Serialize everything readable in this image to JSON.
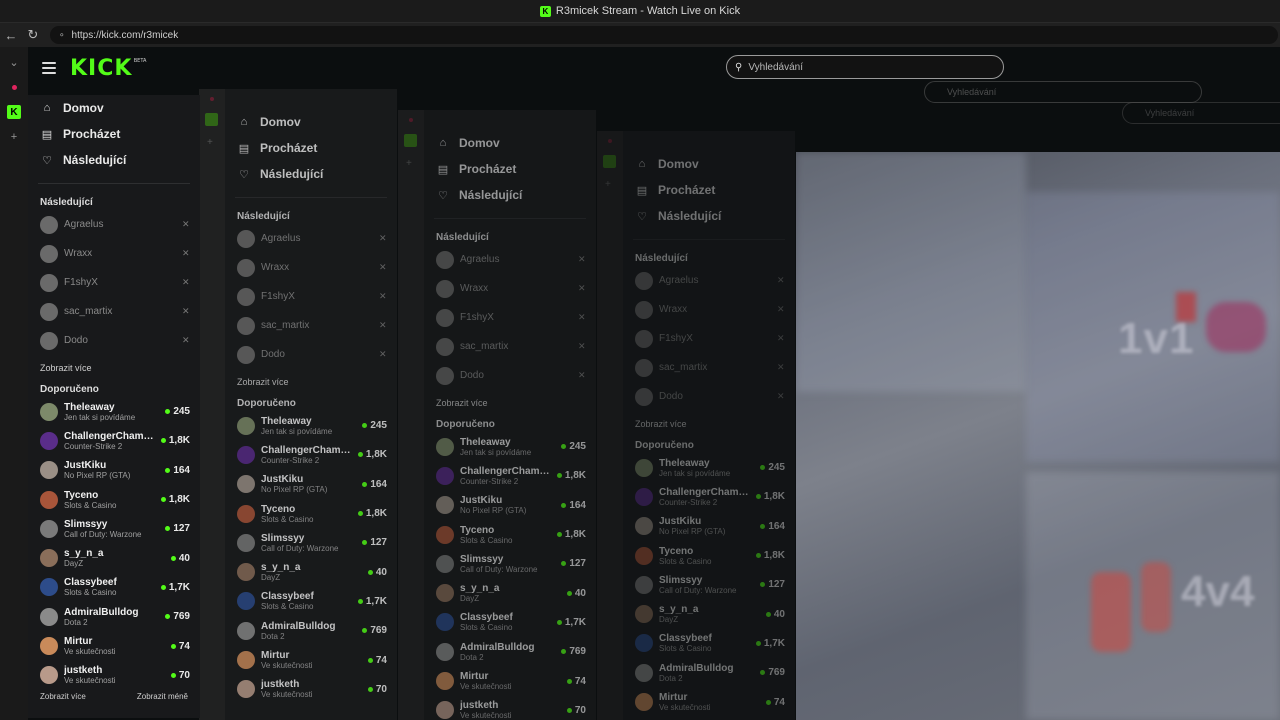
{
  "window": {
    "title": "R3micek Stream - Watch Live on Kick"
  },
  "browser": {
    "url": "https://kick.com/r3micek"
  },
  "header": {
    "logo": "KICK",
    "logo_badge": "BETA",
    "search_placeholder": "Vyhledávání"
  },
  "sidebar": {
    "nav": [
      {
        "label": "Domov",
        "icon": "home-icon"
      },
      {
        "label": "Procházet",
        "icon": "browse-icon"
      },
      {
        "label": "Následující",
        "icon": "heart-icon"
      }
    ],
    "following_title": "Následující",
    "following": [
      {
        "name": "Agraelus"
      },
      {
        "name": "Wraxx"
      },
      {
        "name": "F1shyX"
      },
      {
        "name": "sac_martix"
      },
      {
        "name": "Dodo"
      }
    ],
    "show_more": "Zobrazit více",
    "recommended_title": "Doporučeno",
    "recommended": [
      {
        "name": "Theleaway",
        "category": "Jen tak si povídáme",
        "viewers": "245",
        "color": "#7d8a6a"
      },
      {
        "name": "ChallengerChamp...",
        "category": "Counter-Strike 2",
        "viewers": "1,8K",
        "color": "#5a2d8a"
      },
      {
        "name": "JustKiku",
        "category": "No Pixel RP (GTA)",
        "viewers": "164",
        "color": "#9a8f86"
      },
      {
        "name": "Tyceno",
        "category": "Slots & Casino",
        "viewers": "1,8K",
        "color": "#a8553a"
      },
      {
        "name": "Slimssyy",
        "category": "Call of Duty: Warzone",
        "viewers": "127",
        "color": "#7a7a7a"
      },
      {
        "name": "s_y_n_a",
        "category": "DayZ",
        "viewers": "40",
        "color": "#8a6e5a"
      },
      {
        "name": "Classybeef",
        "category": "Slots & Casino",
        "viewers": "1,7K",
        "color": "#2d4c8a"
      },
      {
        "name": "AdmiralBulldog",
        "category": "Dota 2",
        "viewers": "769",
        "color": "#8a8a8a"
      },
      {
        "name": "Mirtur",
        "category": "Ve skutečnosti",
        "viewers": "74",
        "color": "#c98a5a"
      },
      {
        "name": "justketh",
        "category": "Ve skutečnosti",
        "viewers": "70",
        "color": "#b89a8a"
      }
    ],
    "footer_more": "Zobrazit více",
    "footer_less": "Zobrazit méně"
  },
  "video": {
    "overlay_1": "1v1",
    "overlay_2": "4v4"
  },
  "colors": {
    "accent": "#53fc18",
    "live_dot": "#53fc18",
    "sidebar_bg": "#18191b"
  }
}
